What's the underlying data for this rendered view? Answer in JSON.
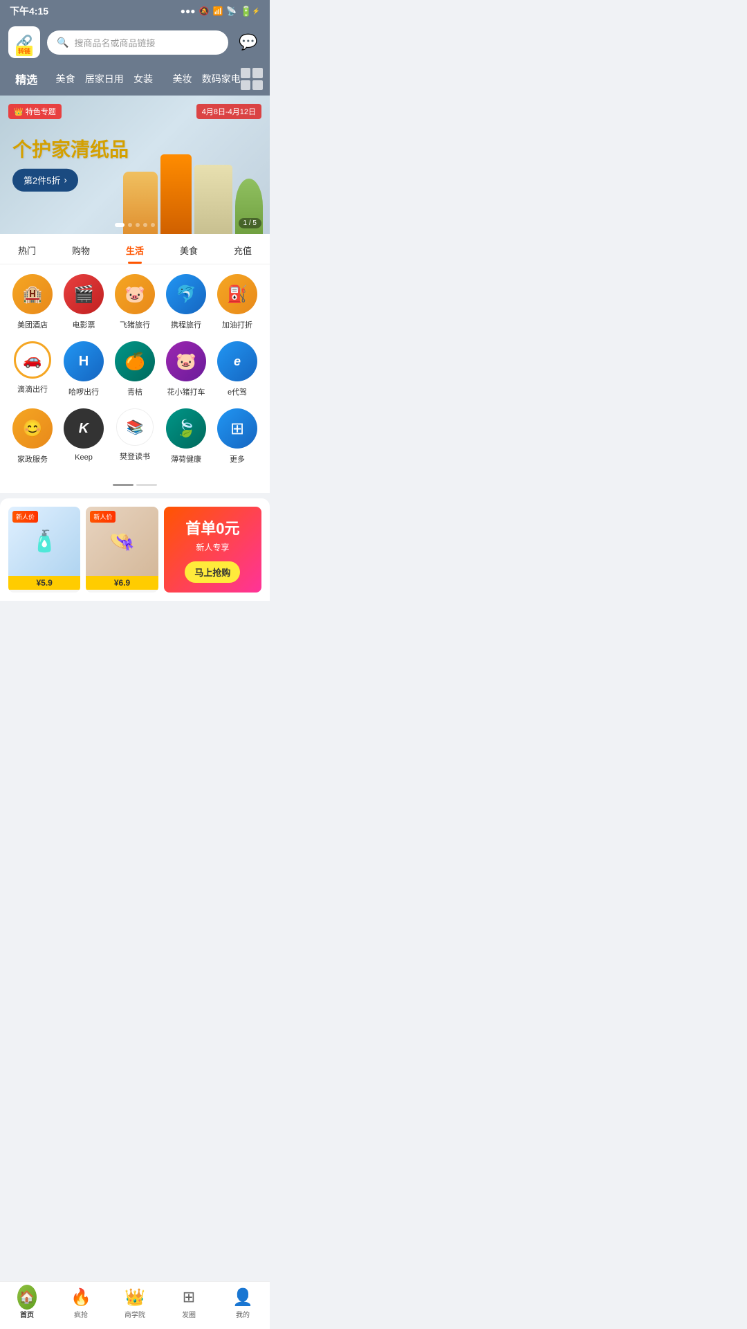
{
  "statusBar": {
    "time": "下午4:15",
    "signal": "●●●",
    "wifi": "wifi",
    "battery": "70"
  },
  "header": {
    "logoLabel": "转链",
    "searchPlaceholder": "搜商品名或商品链接",
    "chatLabel": "消息"
  },
  "navTabs": [
    {
      "id": "jingxuan",
      "label": "精选",
      "active": true
    },
    {
      "id": "meishi",
      "label": "美食",
      "active": false
    },
    {
      "id": "jiaju",
      "label": "居家日用",
      "active": false
    },
    {
      "id": "nvzhuang",
      "label": "女装",
      "active": false
    },
    {
      "id": "meizhuang",
      "label": "美妆",
      "active": false
    },
    {
      "id": "digital",
      "label": "数码家电",
      "active": false
    }
  ],
  "banner": {
    "tag": "特色专题",
    "dateRange": "4月8日-4月12日",
    "title": "个护家清纸品",
    "cta": "第2件5折",
    "ctaArrow": "›",
    "indicator": "1 / 5"
  },
  "categoryTabs": [
    {
      "id": "hotspot",
      "label": "热门",
      "active": false
    },
    {
      "id": "shopping",
      "label": "购物",
      "active": false
    },
    {
      "id": "life",
      "label": "生活",
      "active": true
    },
    {
      "id": "food",
      "label": "美食",
      "active": false
    },
    {
      "id": "recharge",
      "label": "充值",
      "active": false
    }
  ],
  "services": [
    [
      {
        "id": "meituan",
        "label": "美团酒店",
        "emoji": "🏨",
        "colorClass": "icon-meituan"
      },
      {
        "id": "movie",
        "label": "电影票",
        "emoji": "🎬",
        "colorClass": "icon-movie"
      },
      {
        "id": "feizhu",
        "label": "飞猪旅行",
        "emoji": "🐷",
        "colorClass": "icon-feizhu"
      },
      {
        "id": "ctrip",
        "label": "携程旅行",
        "emoji": "🐬",
        "colorClass": "icon-ctrip"
      },
      {
        "id": "gas",
        "label": "加油打折",
        "emoji": "⛽",
        "colorClass": "icon-gas"
      }
    ],
    [
      {
        "id": "didi",
        "label": "滴滴出行",
        "emoji": "🚗",
        "colorClass": "icon-didi"
      },
      {
        "id": "hello",
        "label": "哈啰出行",
        "emoji": "H",
        "colorClass": "icon-hellobike"
      },
      {
        "id": "qingju",
        "label": "青桔",
        "emoji": "🍊",
        "colorClass": "icon-qingju"
      },
      {
        "id": "huaxiaochu",
        "label": "花小猪打车",
        "emoji": "🐷",
        "colorClass": "icon-huaxiaochu"
      },
      {
        "id": "edaijia",
        "label": "e代驾",
        "emoji": "e",
        "colorClass": "icon-edaijia"
      }
    ],
    [
      {
        "id": "jiazh",
        "label": "家政服务",
        "emoji": "😊",
        "colorClass": "icon-jiazh"
      },
      {
        "id": "keep",
        "label": "Keep",
        "emoji": "K",
        "colorClass": "icon-keep"
      },
      {
        "id": "fendeng",
        "label": "樊登读书",
        "emoji": "📚",
        "colorClass": "icon-fendeng"
      },
      {
        "id": "bohe",
        "label": "薄荷健康",
        "emoji": "🍃",
        "colorClass": "icon-bohe"
      },
      {
        "id": "more",
        "label": "更多",
        "emoji": "⊞",
        "colorClass": "icon-more"
      }
    ]
  ],
  "products": [
    {
      "id": "p1",
      "badge": "新人价",
      "price": "¥5.9",
      "emoji": "🧴"
    },
    {
      "id": "p2",
      "badge": "新人价",
      "price": "¥6.9",
      "emoji": "👒"
    }
  ],
  "promo": {
    "title": "首单0元",
    "subtitle": "新人专享",
    "buttonLabel": "马上抢购"
  },
  "bottomNav": [
    {
      "id": "home",
      "label": "首页",
      "active": true,
      "emoji": "🏠"
    },
    {
      "id": "rush",
      "label": "疯抢",
      "active": false,
      "emoji": "🔥"
    },
    {
      "id": "academy",
      "label": "商学院",
      "active": false,
      "emoji": "👑"
    },
    {
      "id": "moments",
      "label": "发圈",
      "active": false,
      "emoji": "⊞"
    },
    {
      "id": "mine",
      "label": "我的",
      "active": false,
      "emoji": "👤"
    }
  ]
}
